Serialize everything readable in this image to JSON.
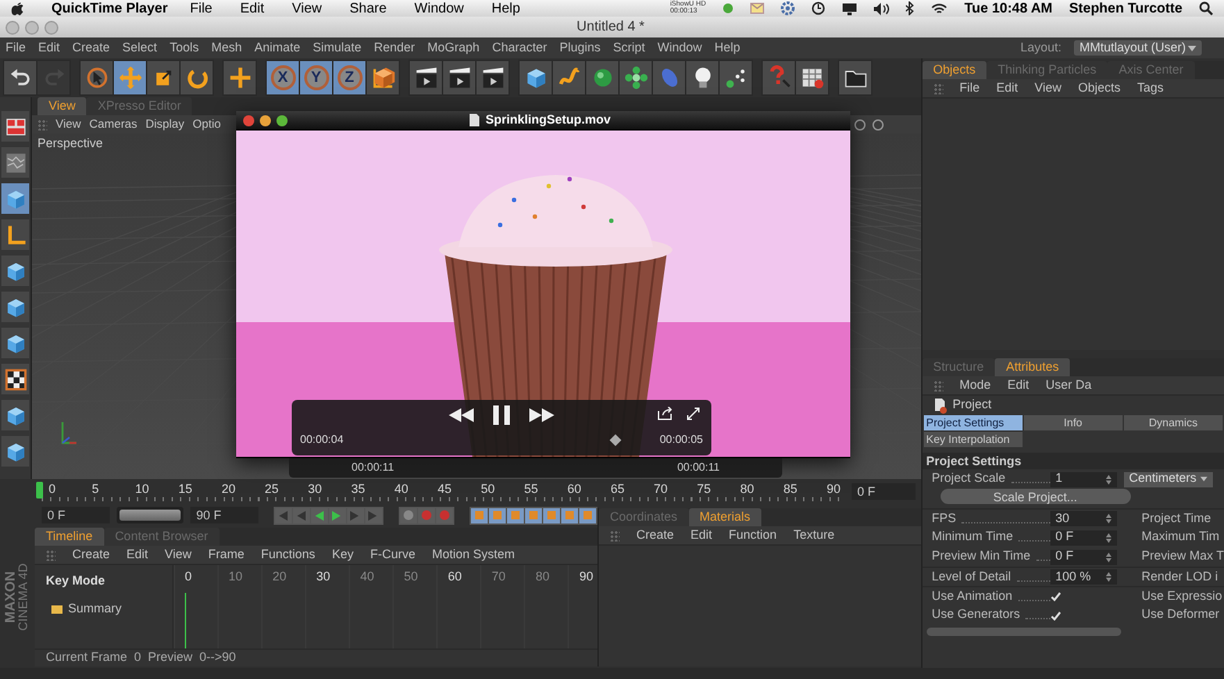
{
  "menubar": {
    "app": "QuickTime Player",
    "menus": [
      "File",
      "Edit",
      "View",
      "Share",
      "Window",
      "Help"
    ],
    "recorder": {
      "name": "iShowU HD",
      "time": "00:00:13"
    },
    "clock": "Tue 10:48 AM",
    "user": "Stephen Turcotte"
  },
  "window": {
    "title": "Untitled 4 *"
  },
  "menu": [
    "File",
    "Edit",
    "Create",
    "Select",
    "Tools",
    "Mesh",
    "Animate",
    "Simulate",
    "Render",
    "MoGraph",
    "Character",
    "Plugins",
    "Script",
    "Window",
    "Help"
  ],
  "layout": {
    "label": "Layout:",
    "value": "MMtutlayout (User)"
  },
  "toolbar": [
    [
      {
        "kind": "undo",
        "selected": false,
        "disabled": false
      },
      {
        "kind": "redo",
        "selected": false,
        "disabled": true
      }
    ],
    [
      {
        "kind": "select",
        "selected": false,
        "disabled": false
      },
      {
        "kind": "move",
        "selected": true,
        "disabled": false
      },
      {
        "kind": "scale",
        "selected": false,
        "disabled": false
      },
      {
        "kind": "rotate",
        "selected": false,
        "disabled": false
      }
    ],
    [
      {
        "kind": "add",
        "selected": false,
        "disabled": false
      }
    ],
    [
      {
        "kind": "axis",
        "label": "X",
        "selected": true,
        "disabled": false
      },
      {
        "kind": "axis",
        "label": "Y",
        "selected": true,
        "disabled": false
      },
      {
        "kind": "axis",
        "label": "Z",
        "selected": true,
        "disabled": false
      },
      {
        "kind": "coords",
        "selected": false,
        "disabled": false
      }
    ],
    [
      {
        "kind": "clapper",
        "selected": false,
        "disabled": false
      },
      {
        "kind": "clapper",
        "selected": false,
        "disabled": false
      },
      {
        "kind": "clapper",
        "selected": false,
        "disabled": false
      }
    ],
    [
      {
        "kind": "cube",
        "selected": false,
        "disabled": false
      },
      {
        "kind": "spline",
        "selected": false,
        "disabled": false
      },
      {
        "kind": "sphere",
        "selected": false,
        "disabled": false
      },
      {
        "kind": "array",
        "selected": false,
        "disabled": false
      },
      {
        "kind": "oval",
        "selected": false,
        "disabled": false
      },
      {
        "kind": "light",
        "selected": false,
        "disabled": false
      },
      {
        "kind": "particles",
        "selected": false,
        "disabled": false
      }
    ],
    [
      {
        "kind": "help",
        "selected": false,
        "disabled": false
      },
      {
        "kind": "calc",
        "selected": false,
        "disabled": false
      }
    ],
    [
      {
        "kind": "folder",
        "selected": false,
        "disabled": false
      }
    ]
  ],
  "modes": [
    {
      "kind": "layout",
      "selected": false
    },
    {
      "kind": "noise",
      "selected": false
    },
    {
      "kind": "cube",
      "selected": true
    },
    {
      "kind": "corner",
      "selected": false
    },
    {
      "kind": "cube",
      "selected": false
    },
    {
      "kind": "cube",
      "selected": false
    },
    {
      "kind": "cube",
      "selected": false
    },
    {
      "kind": "checker",
      "selected": false
    },
    {
      "kind": "cube",
      "selected": false
    },
    {
      "kind": "cube",
      "selected": false
    }
  ],
  "viewport": {
    "tabs": [
      {
        "label": "View",
        "selected": true
      },
      {
        "label": "XPresso Editor",
        "selected": false
      }
    ],
    "menu": [
      "View",
      "Cameras",
      "Display",
      "Optio"
    ],
    "camera": "Perspective"
  },
  "player": {
    "title": "SprinklingSetup.mov",
    "elapsed": "00:00:04",
    "remaining": "00:00:05",
    "level": 0.88
  },
  "ghost_times": [
    "00:00:11",
    "00:00:11"
  ],
  "ruler": {
    "ticks": [
      "0",
      "5",
      "10",
      "15",
      "20",
      "25",
      "30",
      "35",
      "40",
      "45",
      "50",
      "55",
      "60",
      "65",
      "70",
      "75",
      "80",
      "85",
      "90"
    ],
    "end_field": "0 F"
  },
  "transport": {
    "start": "0 F",
    "end": "90 F",
    "level": 1
  },
  "timeline": {
    "tabs": [
      {
        "label": "Timeline",
        "selected": true
      },
      {
        "label": "Content Browser",
        "selected": false
      }
    ],
    "menu": [
      "Create",
      "Edit",
      "View",
      "Frame",
      "Functions",
      "Key",
      "F-Curve",
      "Motion System"
    ],
    "mode": "Key Mode",
    "ticks": [
      "0",
      "10",
      "20",
      "30",
      "40",
      "50",
      "60",
      "70",
      "80",
      "90"
    ],
    "tracks": [
      "Summary"
    ],
    "status": [
      "Current Frame",
      "0",
      "Preview",
      "0-->90"
    ]
  },
  "logo": [
    "MAXON",
    "CINEMA 4D"
  ],
  "materials": {
    "tabs": [
      {
        "label": "Coordinates",
        "selected": false
      },
      {
        "label": "Materials",
        "selected": true
      }
    ],
    "menu": [
      "Create",
      "Edit",
      "Function",
      "Texture"
    ]
  },
  "objects": {
    "tabs": [
      {
        "label": "Objects",
        "selected": true
      },
      {
        "label": "Thinking Particles",
        "selected": false
      },
      {
        "label": "Axis Center",
        "selected": false
      }
    ],
    "menu": [
      "File",
      "Edit",
      "View",
      "Objects",
      "Tags"
    ]
  },
  "attributes": {
    "tabs": [
      {
        "label": "Structure",
        "selected": false
      },
      {
        "label": "Attributes",
        "selected": true
      }
    ],
    "menu": [
      "Mode",
      "Edit",
      "User Da"
    ],
    "object": "Project",
    "pages": [
      {
        "label": "Project Settings",
        "selected": true
      },
      {
        "label": "Info",
        "selected": false
      },
      {
        "label": "Dynamics",
        "selected": false
      },
      {
        "label": "Key Interpolation",
        "selected": false
      }
    ],
    "section": "Project Settings",
    "scale": {
      "label": "Project Scale",
      "value": "1",
      "unit": "Centimeters"
    },
    "scale_button": "Scale Project...",
    "fields": [
      {
        "label": "FPS",
        "value": "30",
        "right": "Project Time"
      },
      {
        "label": "Minimum Time",
        "value": "0 F",
        "right": "Maximum Tim"
      },
      {
        "label": "Preview Min Time",
        "value": "0 F",
        "right": "Preview Max T"
      }
    ],
    "lod": {
      "label": "Level of Detail",
      "value": "100 %",
      "right": "Render LOD i"
    },
    "checks": [
      {
        "label": "Use Animation",
        "checked": true,
        "right": "Use Expressio"
      },
      {
        "label": "Use Generators",
        "checked": true,
        "right": "Use Deformer"
      }
    ]
  }
}
